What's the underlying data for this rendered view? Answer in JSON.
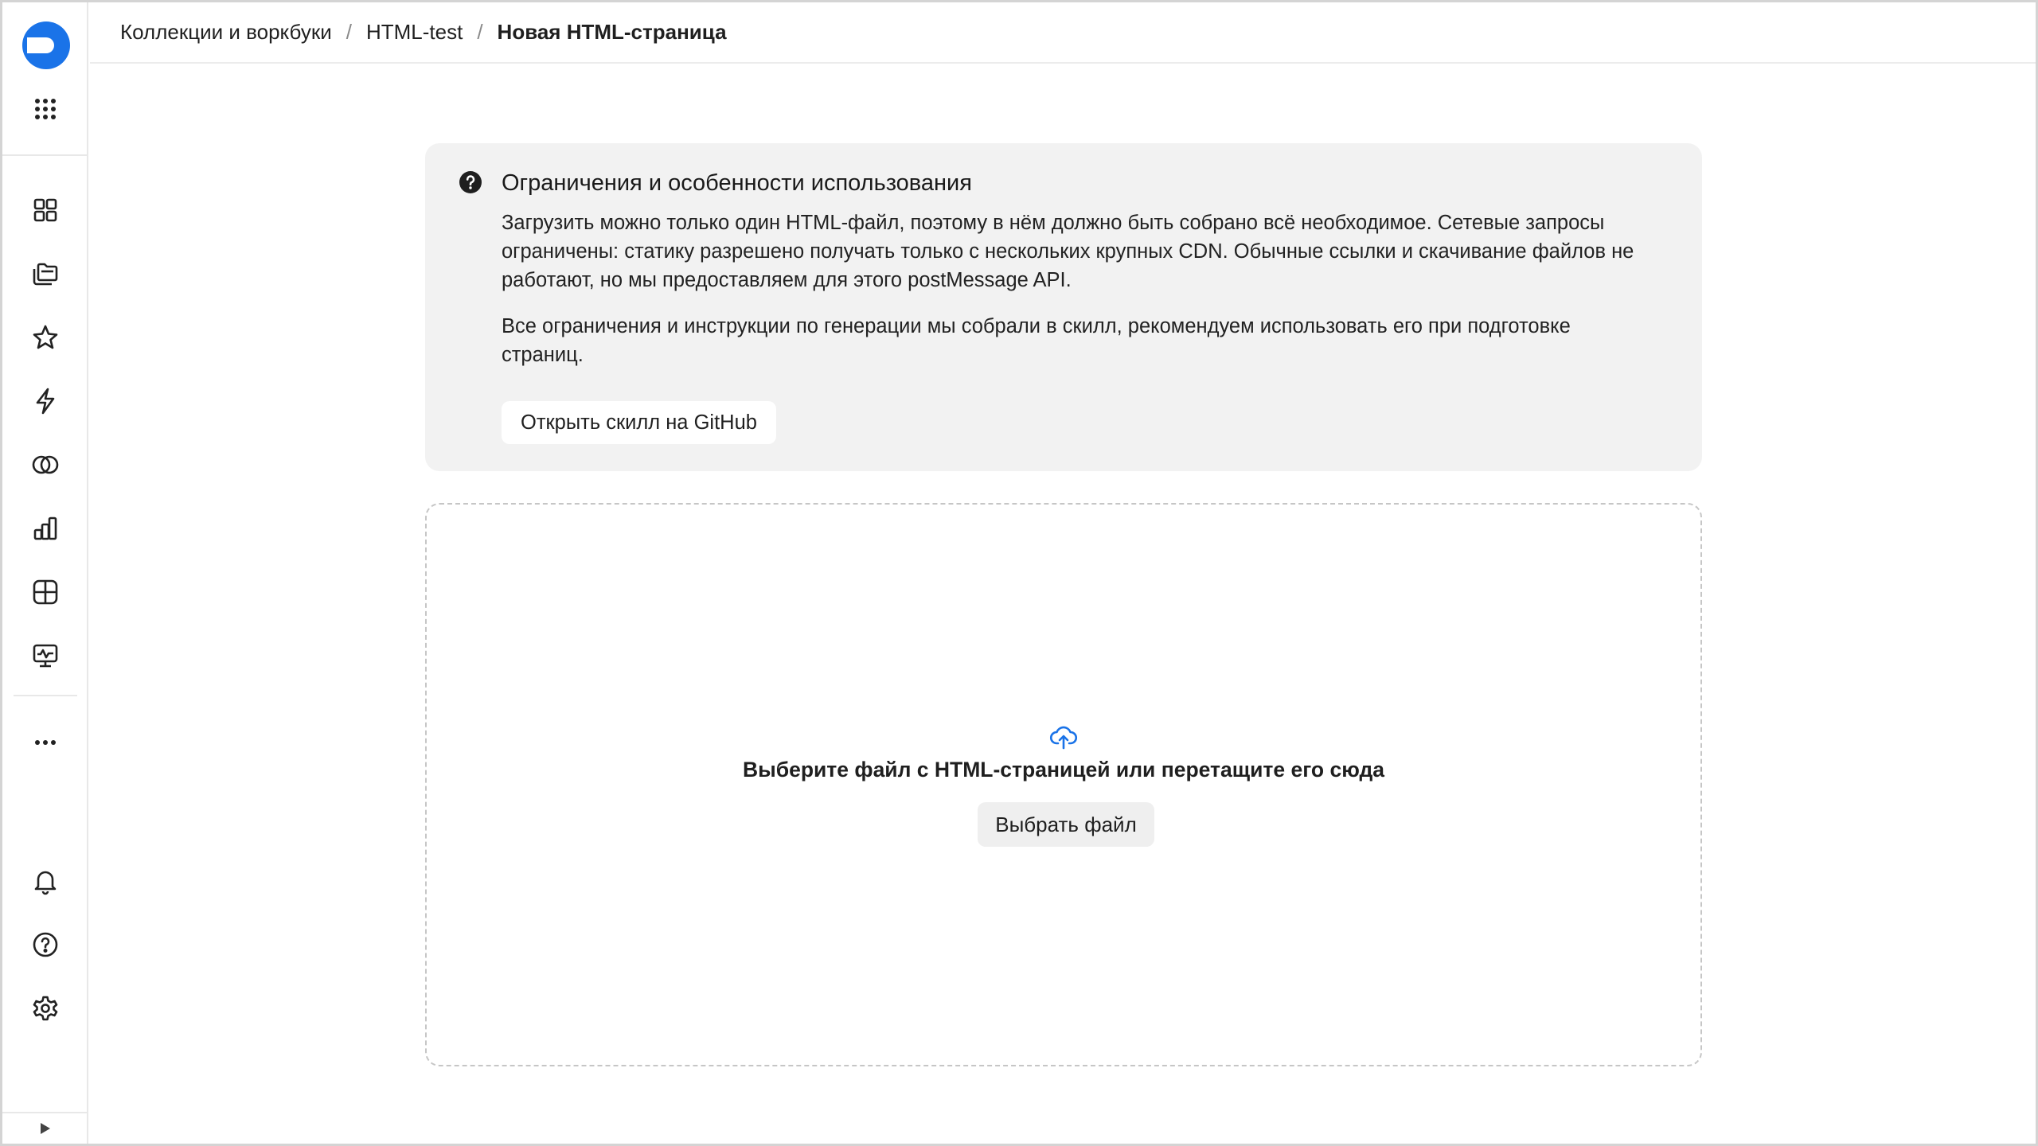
{
  "colors": {
    "accent": "#1a73e8",
    "info_bg": "#f2f2f2",
    "border": "#e8e8e8",
    "text": "#1f1f1f"
  },
  "sidebar": {
    "logo": "app-logo",
    "top_icons": [
      "apps-grid-icon"
    ],
    "nav_icons": [
      "dashboard-grid-icon",
      "collections-icon",
      "star-icon",
      "lightning-icon",
      "connections-icon",
      "charts-icon",
      "datasets-icon",
      "monitor-icon",
      "more-icon"
    ],
    "bottom_icons": [
      "bell-icon",
      "help-icon",
      "gear-icon"
    ],
    "collapse_icon": "expand-arrow-icon"
  },
  "breadcrumb": {
    "items": [
      "Коллекции и воркбуки",
      "HTML-test"
    ],
    "separator": "/",
    "current": "Новая HTML-страница"
  },
  "info": {
    "icon": "question-circle-icon",
    "title": "Ограничения и особенности использования",
    "paragraph1": "Загрузить можно только один HTML-файл, поэтому в нём должно быть собрано всё необходимое. Сетевые запросы ограничены: статику разрешено получать только с нескольких крупных CDN. Обычные ссылки и скачивание файлов не работают, но мы предоставляем для этого postMessage API.",
    "paragraph2": "Все ограничения и инструкции по генерации мы собрали в скилл, рекомендуем использовать его при подготовке страниц.",
    "button_label": "Открыть скилл на GitHub"
  },
  "dropzone": {
    "icon": "cloud-upload-icon",
    "text": "Выберите файл с HTML-страницей или перетащите его сюда",
    "button_label": "Выбрать файл"
  }
}
